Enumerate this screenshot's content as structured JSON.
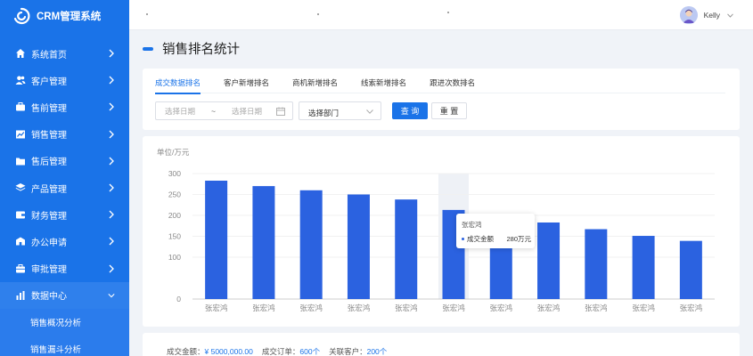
{
  "app": {
    "title": "CRM管理系统"
  },
  "sidebar": {
    "items": [
      {
        "label": "系统首页",
        "icon": "home-icon"
      },
      {
        "label": "客户管理",
        "icon": "users-icon"
      },
      {
        "label": "售前管理",
        "icon": "briefcase-icon"
      },
      {
        "label": "销售管理",
        "icon": "trend-chart-icon"
      },
      {
        "label": "售后管理",
        "icon": "folder-icon"
      },
      {
        "label": "产品管理",
        "icon": "layers-icon"
      },
      {
        "label": "财务管理",
        "icon": "wallet-icon"
      },
      {
        "label": "办公申请",
        "icon": "building-icon"
      },
      {
        "label": "审批管理",
        "icon": "toolbox-icon"
      },
      {
        "label": "数据中心",
        "icon": "bar-chart-icon"
      }
    ],
    "sub_items": [
      {
        "label": "销售概况分析"
      },
      {
        "label": "销售漏斗分析"
      }
    ]
  },
  "topbar": {
    "username": "Kelly"
  },
  "page": {
    "title": "销售排名统计"
  },
  "tabs": [
    {
      "label": "成交数据排名"
    },
    {
      "label": "客户新增排名"
    },
    {
      "label": "商机新增排名"
    },
    {
      "label": "线索新增排名"
    },
    {
      "label": "跟进次数排名"
    }
  ],
  "filters": {
    "start_placeholder": "选择日期",
    "separator": "~",
    "end_placeholder": "选择日期",
    "department_placeholder": "选择部门",
    "search_label": "查 询",
    "reset_label": "重 置"
  },
  "chart_data": {
    "type": "bar",
    "unit_label": "单位/万元",
    "categories": [
      "张宏鸿",
      "张宏鸿",
      "张宏鸿",
      "张宏鸿",
      "张宏鸿",
      "张宏鸿",
      "张宏鸿",
      "张宏鸿",
      "张宏鸿",
      "张宏鸿",
      "张宏鸿"
    ],
    "values": [
      283,
      270,
      260,
      250,
      238,
      213,
      195,
      183,
      167,
      151,
      139
    ],
    "ylim": [
      0,
      300
    ],
    "yticks": [
      0,
      100,
      150,
      200,
      250,
      300
    ],
    "bar_color": "#2b62e0",
    "highlight_index": 5,
    "tooltip": {
      "title": "张宏鸿",
      "series_label": "成交金额",
      "value": "280万元"
    }
  },
  "summary": {
    "amount_label": "成交金额：",
    "amount_value": "¥ 5000,000.00",
    "orders_label": "成交订单：",
    "orders_value": "600个",
    "customers_label": "关联客户：",
    "customers_value": "200个"
  }
}
